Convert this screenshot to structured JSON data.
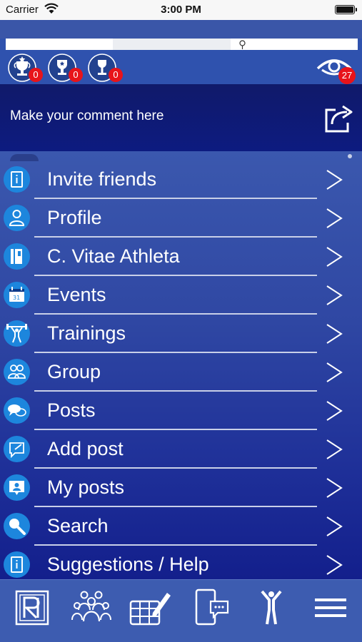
{
  "status_bar": {
    "carrier": "Carrier",
    "time": "3:00 PM"
  },
  "profile": {
    "trophies": [
      {
        "icon": "trophy-star-icon",
        "count": "0"
      },
      {
        "icon": "trophy-medal-icon",
        "count": "0"
      },
      {
        "icon": "trophy-cup-icon",
        "count": "0"
      }
    ],
    "views": {
      "icon": "eye-icon",
      "count": "27"
    }
  },
  "comment": {
    "placeholder": "Make your comment here",
    "icon": "share-icon"
  },
  "menu": {
    "items": [
      {
        "label": "Invite friends",
        "icon": "info-icon"
      },
      {
        "label": "Profile",
        "icon": "user-icon"
      },
      {
        "label": "C. Vitae Athleta",
        "icon": "book-icon"
      },
      {
        "label": "Events",
        "icon": "calendar-icon"
      },
      {
        "label": "Trainings",
        "icon": "weightlifter-icon"
      },
      {
        "label": "Group",
        "icon": "group-icon"
      },
      {
        "label": "Posts",
        "icon": "chat-bubbles-icon"
      },
      {
        "label": "Add post",
        "icon": "add-post-icon"
      },
      {
        "label": "My posts",
        "icon": "my-posts-icon"
      },
      {
        "label": "Search",
        "icon": "search-icon"
      },
      {
        "label": "Suggestions / Help",
        "icon": "info-icon"
      }
    ],
    "chevron_icon": "chevron-right-icon"
  },
  "tab_bar": {
    "tabs": [
      {
        "icon": "logo-icon"
      },
      {
        "icon": "people-icon"
      },
      {
        "icon": "calendar-edit-icon"
      },
      {
        "icon": "phone-chat-icon"
      },
      {
        "icon": "athlete-icon"
      },
      {
        "icon": "hamburger-menu-icon"
      }
    ]
  },
  "colors": {
    "header": "#2f52ae",
    "comment_bg": "#0d1b80",
    "icon_circle": "#1d86dd",
    "badge": "#e8131a",
    "tab_bar": "#3d5cb0"
  }
}
